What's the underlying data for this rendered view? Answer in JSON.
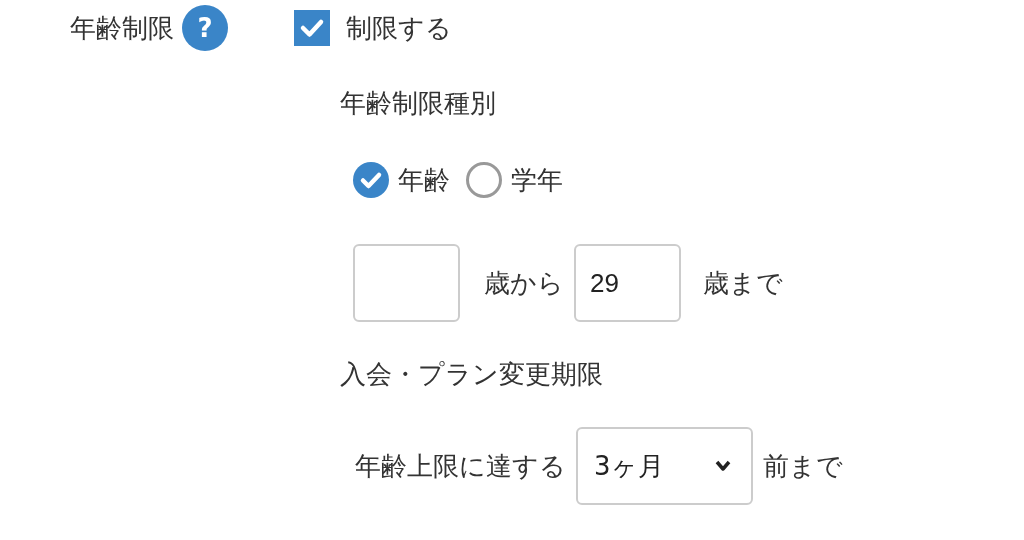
{
  "age_limit": {
    "label": "年齢制限",
    "help": "?",
    "checkbox": {
      "label": "制限する",
      "checked": true
    }
  },
  "limit_type": {
    "heading": "年齢制限種別",
    "options": [
      {
        "label": "年齢",
        "selected": true
      },
      {
        "label": "学年",
        "selected": false
      }
    ]
  },
  "range": {
    "from_suffix": "歳から",
    "to": {
      "value": "29"
    },
    "to_suffix": "歳まで"
  },
  "deadline": {
    "heading": "入会・プラン変更期限",
    "prefix": "年齢上限に達する",
    "select": {
      "value": "3ヶ月"
    },
    "suffix": "前まで"
  }
}
